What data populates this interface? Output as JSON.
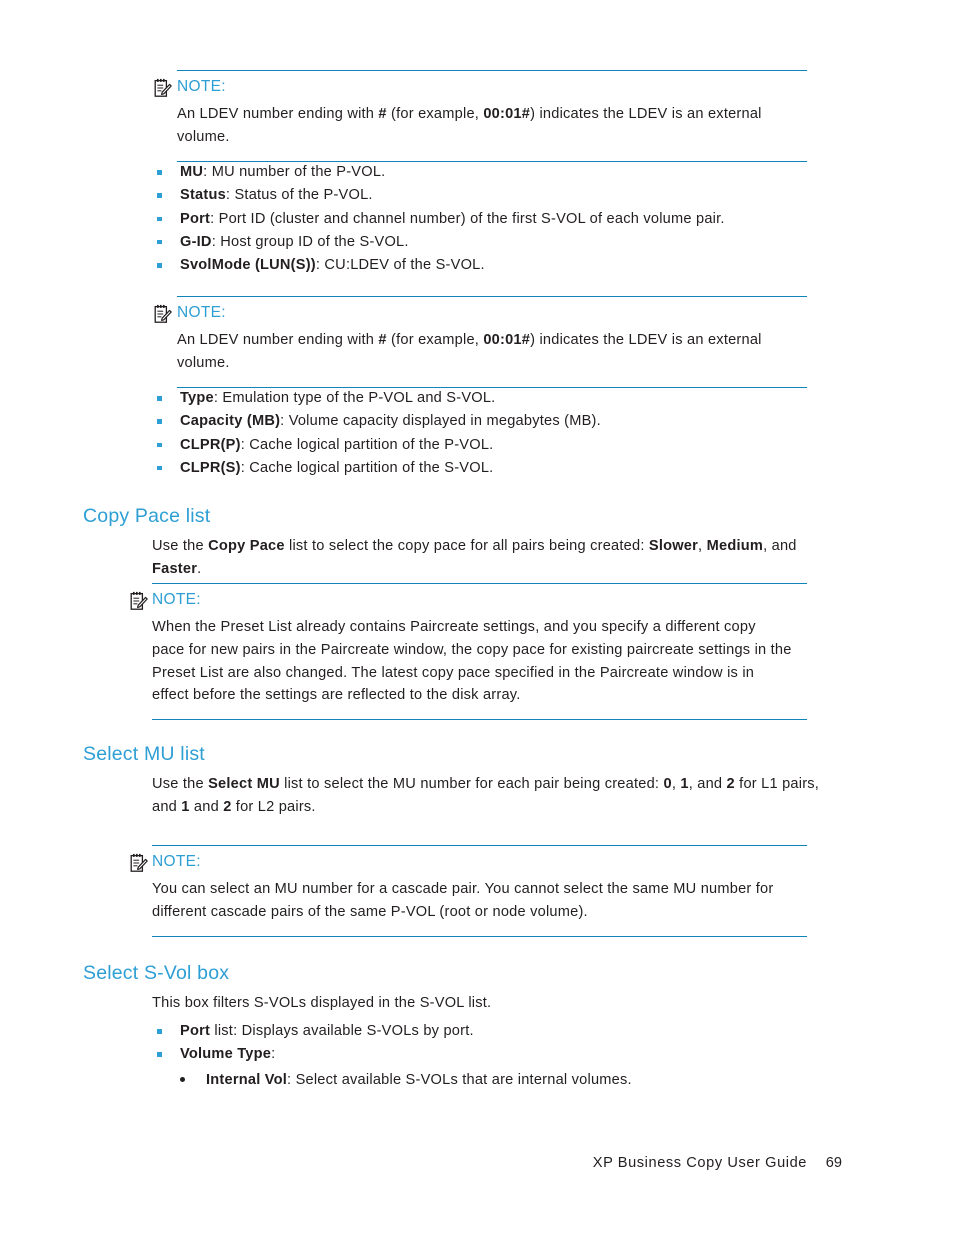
{
  "document": {
    "footer_title": "XP Business Copy User Guide",
    "footer_page": "69",
    "note_label": "NOTE:",
    "note_icon": "note-pad-pen-icon",
    "accent_color": "#2e9fd4",
    "rule_color": "#1184b8",
    "text_color": "#231f20"
  },
  "notes": {
    "ldev_external_1": {
      "label": "NOTE:",
      "body_parts": [
        {
          "text": "An LDEV number ending with ",
          "bold": false
        },
        {
          "text": "#",
          "bold": true
        },
        {
          "text": " (for example, ",
          "bold": false
        },
        {
          "text": "00:01#",
          "bold": true
        },
        {
          "text": ") indicates the LDEV is an external volume.",
          "bold": false
        }
      ],
      "body_plain": "An LDEV number ending with # (for example, 00:01#) indicates the LDEV is an external volume."
    },
    "ldev_external_2": {
      "label": "NOTE:",
      "body_plain": "An LDEV number ending with # (for example, 00:01#) indicates the LDEV is an external volume."
    },
    "copy_pace": {
      "label": "NOTE:",
      "body_plain": "When the Preset List already contains Paircreate settings, and you specify a different copy pace for new pairs in the Paircreate window, the copy pace for existing paircreate settings in the Preset List are also changed. The latest copy pace specified in the Paircreate window is in effect before the settings are reflected to the disk array."
    },
    "select_mu": {
      "label": "NOTE:",
      "body_plain": "You can select an MU number for a cascade pair. You cannot select the same MU number for different cascade pairs of the same P-VOL (root or node volume)."
    }
  },
  "list_one": {
    "items": [
      {
        "term": "MU",
        "desc": ": MU number of the P-VOL."
      },
      {
        "term": "Status",
        "desc": ": Status of the P-VOL."
      },
      {
        "term": "Port",
        "desc": ": Port ID (cluster and channel number) of the first S-VOL of each volume pair."
      },
      {
        "term": "G-ID",
        "desc": ": Host group ID of the S-VOL."
      },
      {
        "term": "SvolMode (LUN(S))",
        "desc": ": CU:LDEV of the S-VOL."
      }
    ]
  },
  "list_two": {
    "items": [
      {
        "term": "Type",
        "desc": ": Emulation type of the P-VOL and S-VOL."
      },
      {
        "term": "Capacity (MB)",
        "desc": ": Volume capacity displayed in megabytes (MB)."
      },
      {
        "term": "CLPR(P)",
        "desc": ": Cache logical partition of the P-VOL."
      },
      {
        "term": "CLPR(S)",
        "desc": ": Cache logical partition of the S-VOL."
      }
    ]
  },
  "sections": {
    "copy_pace": {
      "heading": "Copy Pace list",
      "paragraph_parts": [
        {
          "text": "Use the ",
          "bold": false
        },
        {
          "text": "Copy Pace",
          "bold": true
        },
        {
          "text": " list to select the copy pace for all pairs being created: ",
          "bold": false
        },
        {
          "text": "Slower",
          "bold": true
        },
        {
          "text": ", ",
          "bold": false
        },
        {
          "text": "Medium",
          "bold": true
        },
        {
          "text": ", and ",
          "bold": false
        },
        {
          "text": "Faster",
          "bold": true
        },
        {
          "text": ".",
          "bold": false
        }
      ],
      "paragraph_plain": "Use the Copy Pace list to select the copy pace for all pairs being created: Slower, Medium, and Faster."
    },
    "select_mu": {
      "heading": "Select MU list",
      "paragraph_plain": "Use the Select MU list to select the MU number for each pair being created: 0, 1, and 2 for L1 pairs, and 1 and 2 for L2 pairs."
    },
    "select_svol": {
      "heading": "Select S-Vol box",
      "paragraph_plain": "This box filters S-VOLs displayed in the S-VOL list.",
      "items": [
        {
          "term": "Port",
          "desc": " list: Displays available S-VOLs by port."
        },
        {
          "term": "Volume Type",
          "desc": ":"
        }
      ],
      "sub_items": [
        {
          "term": "Internal Vol",
          "desc": ": Select available S-VOLs that are internal volumes."
        }
      ]
    }
  }
}
